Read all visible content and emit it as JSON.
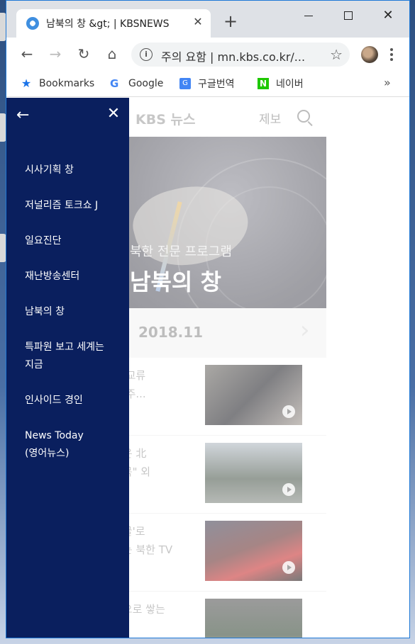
{
  "browser": {
    "tab": {
      "title": "남북의 창 &gt; | KBSNEWS",
      "close_glyph": "✕"
    },
    "new_tab_glyph": "+",
    "window_controls": {
      "minimize": "minimize-icon",
      "maximize": "maximize-icon",
      "close": "✕"
    },
    "toolbar": {
      "back_glyph": "←",
      "forward_glyph": "→",
      "reload_glyph": "↻",
      "home_glyph": "⌂",
      "omnibox": {
        "info_glyph": "i",
        "url_text": "주의 요함 | mn.kbs.co.kr/...",
        "star_glyph": "☆"
      }
    },
    "bookmarks": [
      {
        "label": "Bookmarks",
        "icon": "★"
      },
      {
        "label": "Google",
        "icon": "G"
      },
      {
        "label": "구글번역",
        "icon": "G"
      },
      {
        "label": "네이버",
        "icon": "N"
      }
    ],
    "bookmarks_more": "»"
  },
  "page": {
    "header": {
      "logo": "KBS 뉴스",
      "report": "제보"
    },
    "hero": {
      "subtitle": "북한 전문 프로그램",
      "title": "남북의 창"
    },
    "date_bar": {
      "date": "2018.11",
      "next_glyph": "›"
    },
    "news": [
      {
        "line1": "북 교류",
        "line2": "음 주..."
      },
      {
        "line1": "품은 北",
        "line2": "팀목\" 외"
      },
      {
        "line1": "얼굴'로",
        "line2": "하는 북한 TV"
      },
      {
        "line1": "악으로 쌓는",
        "line2": ""
      }
    ]
  },
  "drawer": {
    "back_glyph": "←",
    "close_glyph": "✕",
    "items": [
      {
        "label": "시사기획 창"
      },
      {
        "label": "저널리즘 토크쇼 J"
      },
      {
        "label": "일요진단"
      },
      {
        "label": "재난방송센터"
      },
      {
        "label": "남북의 창"
      },
      {
        "label": "특파원 보고 세계는",
        "label2": "지금"
      },
      {
        "label": "인사이드 경인"
      },
      {
        "label": "News Today",
        "label2": "(영어뉴스)"
      }
    ]
  },
  "colors": {
    "drawer_bg": "#0a1f5e",
    "window_border": "#1e78d6"
  }
}
